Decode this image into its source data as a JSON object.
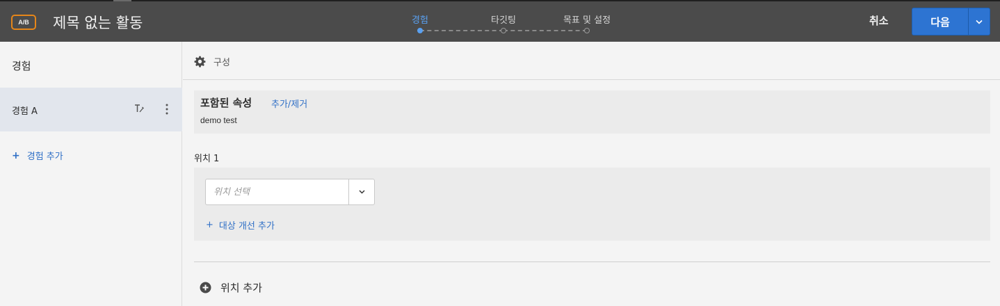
{
  "header": {
    "badge": "A/B",
    "title": "제목 없는 활동",
    "steps": [
      {
        "label": "경험",
        "active": true
      },
      {
        "label": "타깃팅",
        "active": false
      },
      {
        "label": "목표 및 설정",
        "active": false
      }
    ],
    "cancel_label": "취소",
    "next_label": "다음",
    "next_dropdown_icon": "chevron-down-icon"
  },
  "sidebar": {
    "title": "경험",
    "items": [
      {
        "label": "경험 A",
        "selected": true,
        "icons": [
          "rename-icon",
          "more-vertical-icon"
        ]
      }
    ],
    "add_label": "경험 추가"
  },
  "main": {
    "config_label": "구성",
    "config_icon": "gear-icon",
    "included_props_title": "포함된 속성",
    "included_props_link": "추가/제거",
    "included_props_value": "demo test",
    "location_label": "위치 1",
    "location_placeholder": "위치 선택",
    "add_improvement_label": "대상 개선 추가",
    "add_location_label": "위치 추가"
  },
  "colors": {
    "header_bg": "#4b4b4b",
    "accent": "#2d74d2",
    "link": "#2f6fc6",
    "badge_border": "#e68619",
    "active_step": "#5aa0f0"
  }
}
